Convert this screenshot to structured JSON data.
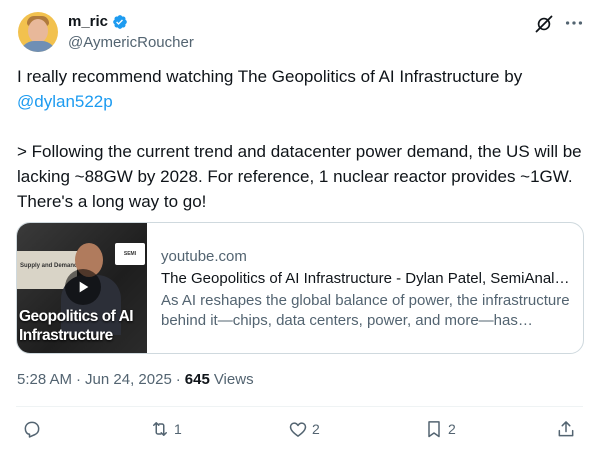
{
  "author": {
    "display_name": "m_ric",
    "handle": "@AymericRoucher",
    "verified": true
  },
  "tweet": {
    "line1": "I really recommend watching The Geopolitics of AI Infrastructure by",
    "mention": "@dylan522p",
    "quote": "> Following the current trend and datacenter power demand, the US will be lacking ~88GW by 2028. For reference, 1 nuclear reactor provides ~1GW. There's a long way to go!"
  },
  "card": {
    "domain": "youtube.com",
    "title": "The Geopolitics of AI Infrastructure - Dylan Patel, SemiAnalysis",
    "description": "As AI reshapes the global balance of power, the infrastructure behind it—chips, data centers, power, and more—has become a new geopolitical battleground.",
    "thumbnail_text": "Geopolitics of AI Infrastructure",
    "thumbnail_panel_text": "Supply and Demand"
  },
  "meta": {
    "time": "5:28 AM",
    "separator": "·",
    "date": "Jun 24, 2025",
    "views_count": "645",
    "views_label": "Views"
  },
  "actions": {
    "replies": "",
    "retweets": "1",
    "likes": "2",
    "bookmarks": "2"
  },
  "icons": {
    "verified": "verified-badge-icon",
    "grok": "grok-icon",
    "more": "more-icon",
    "reply": "reply-icon",
    "retweet": "retweet-icon",
    "like": "heart-icon",
    "bookmark": "bookmark-icon",
    "share": "share-icon"
  },
  "colors": {
    "accent": "#1d9bf0",
    "secondary_text": "#536471",
    "primary_text": "#0f1419",
    "border": "#cfd9de"
  }
}
